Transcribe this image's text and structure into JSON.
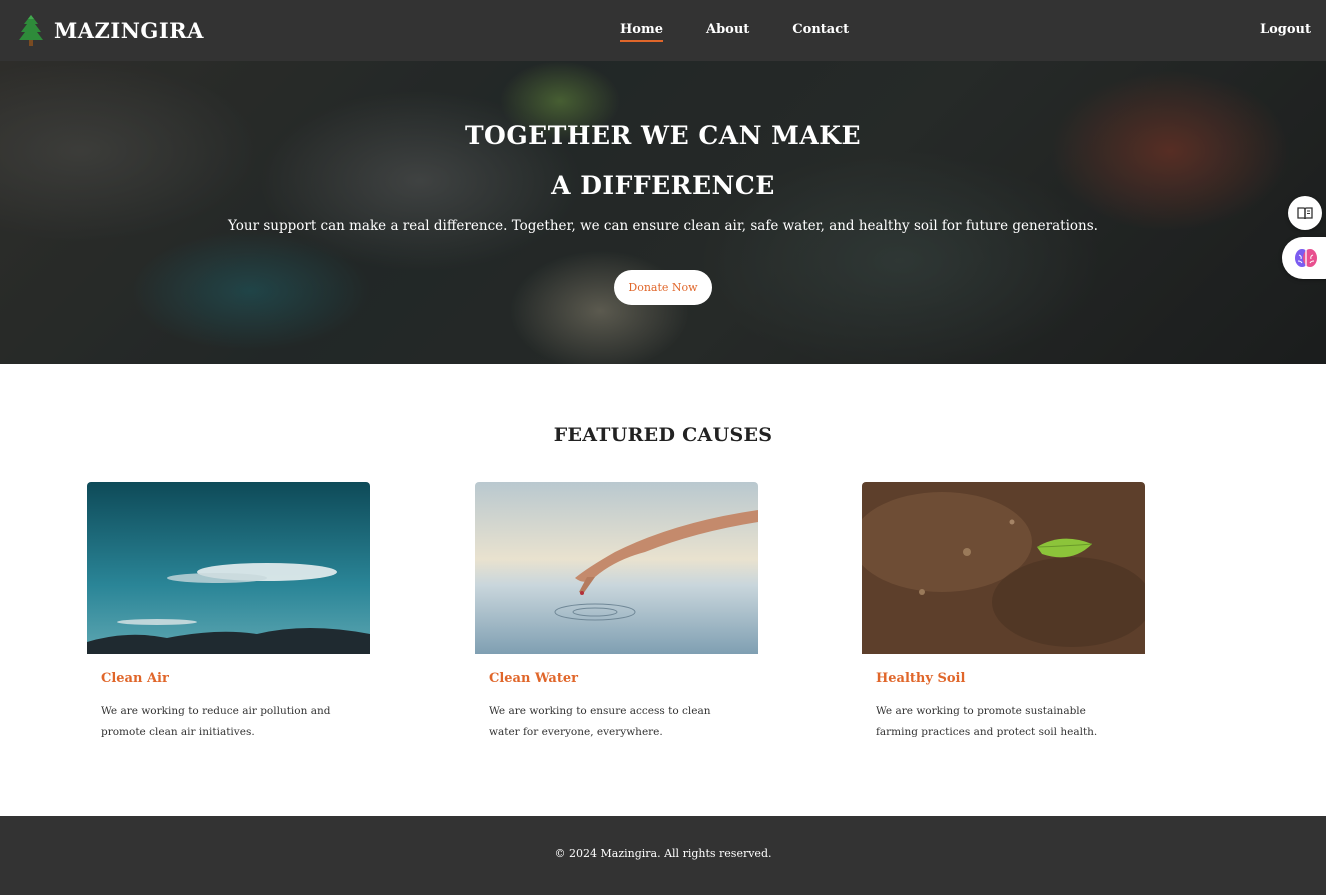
{
  "nav": {
    "brand": "MAZINGIRA",
    "links": [
      "Home",
      "About",
      "Contact"
    ],
    "logout": "Logout"
  },
  "hero": {
    "title_line1": "TOGETHER WE CAN MAKE",
    "title_line2": "A DIFFERENCE",
    "subtitle": "Your support can make a real difference. Together, we can ensure clean air, safe water, and healthy soil for future generations.",
    "cta": "Donate Now"
  },
  "featured": {
    "title": "FEATURED CAUSES",
    "causes": [
      {
        "title": "Clean Air",
        "desc": "We are working to reduce air pollution and promote clean air initiatives."
      },
      {
        "title": "Clean Water",
        "desc": "We are working to ensure access to clean water for everyone, everywhere."
      },
      {
        "title": "Healthy Soil",
        "desc": "We are working to promote sustainable farming practices and protect soil health."
      }
    ]
  },
  "footer": {
    "copyright": "© 2024 Mazingira. All rights reserved."
  },
  "colors": {
    "accent": "#e0662a",
    "dark": "#333333"
  },
  "icons": [
    "tree-icon",
    "reader-icon",
    "brain-icon"
  ]
}
